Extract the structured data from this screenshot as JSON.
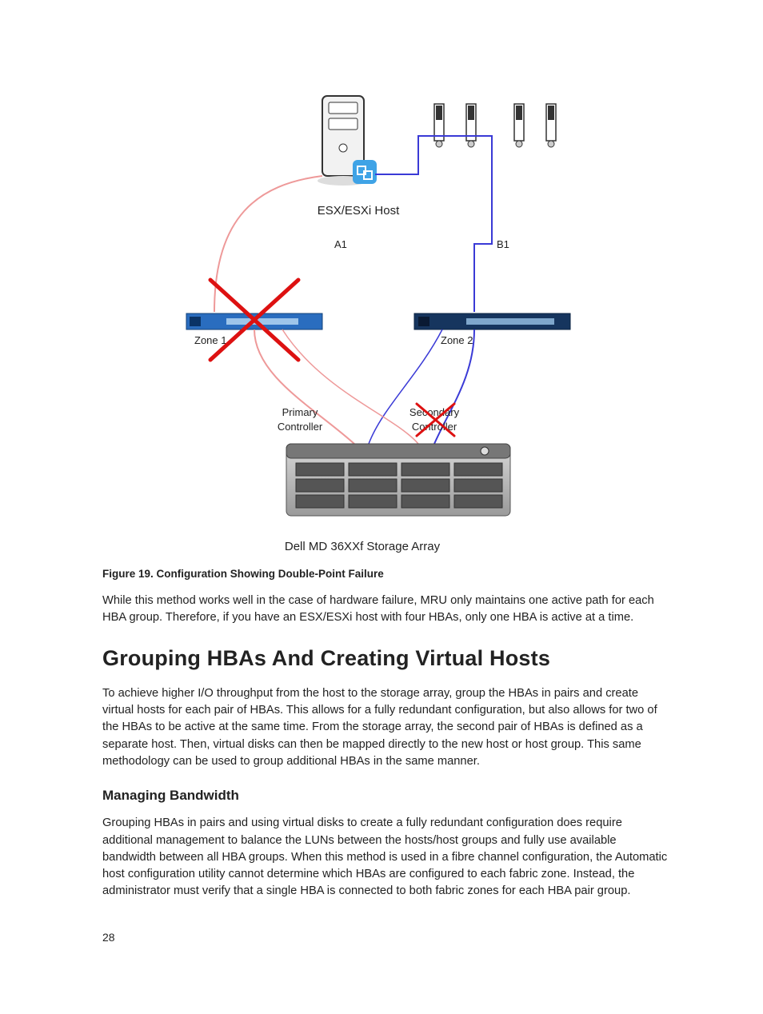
{
  "diagram": {
    "host_label": "ESX/ESXi Host",
    "path_a": "A1",
    "path_b": "B1",
    "zone1": "Zone 1",
    "zone2": "Zone 2",
    "primary_ctrl_l1": "Primary",
    "primary_ctrl_l2": "Controller",
    "secondary_ctrl_l1": "Secondary",
    "secondary_ctrl_l2": "Controller",
    "array_label": "Dell MD 36XXf Storage Array"
  },
  "figure_caption": "Figure 19. Configuration Showing Double-Point Failure",
  "para_intro": "While this method works well in the case of hardware failure, MRU only maintains one active path for each HBA group. Therefore, if you have an ESX/ESXi host with four HBAs, only one HBA is active at a time.",
  "heading_main": "Grouping HBAs And Creating Virtual Hosts",
  "para_main": "To achieve higher I/O throughput from the host to the storage array, group the HBAs in pairs and create virtual hosts for each pair of HBAs. This allows for a fully redundant configuration, but also allows for two of the HBAs to be active at the same time. From the storage array, the second pair of HBAs is defined as a separate host. Then, virtual disks can then be mapped directly to the new host or host group. This same methodology can be used to group additional HBAs in the same manner.",
  "heading_sub": "Managing Bandwidth",
  "para_sub": "Grouping HBAs in pairs and using virtual disks to create a fully redundant configuration does require additional management to balance the LUNs between the hosts/host groups and fully use available bandwidth between all HBA groups. When this method is used in a fibre channel configuration, the Automatic host configuration utility cannot determine which HBAs are configured to each fabric zone. Instead, the administrator must verify that a single HBA is connected to both fabric zones for each HBA pair group.",
  "page_number": "28"
}
